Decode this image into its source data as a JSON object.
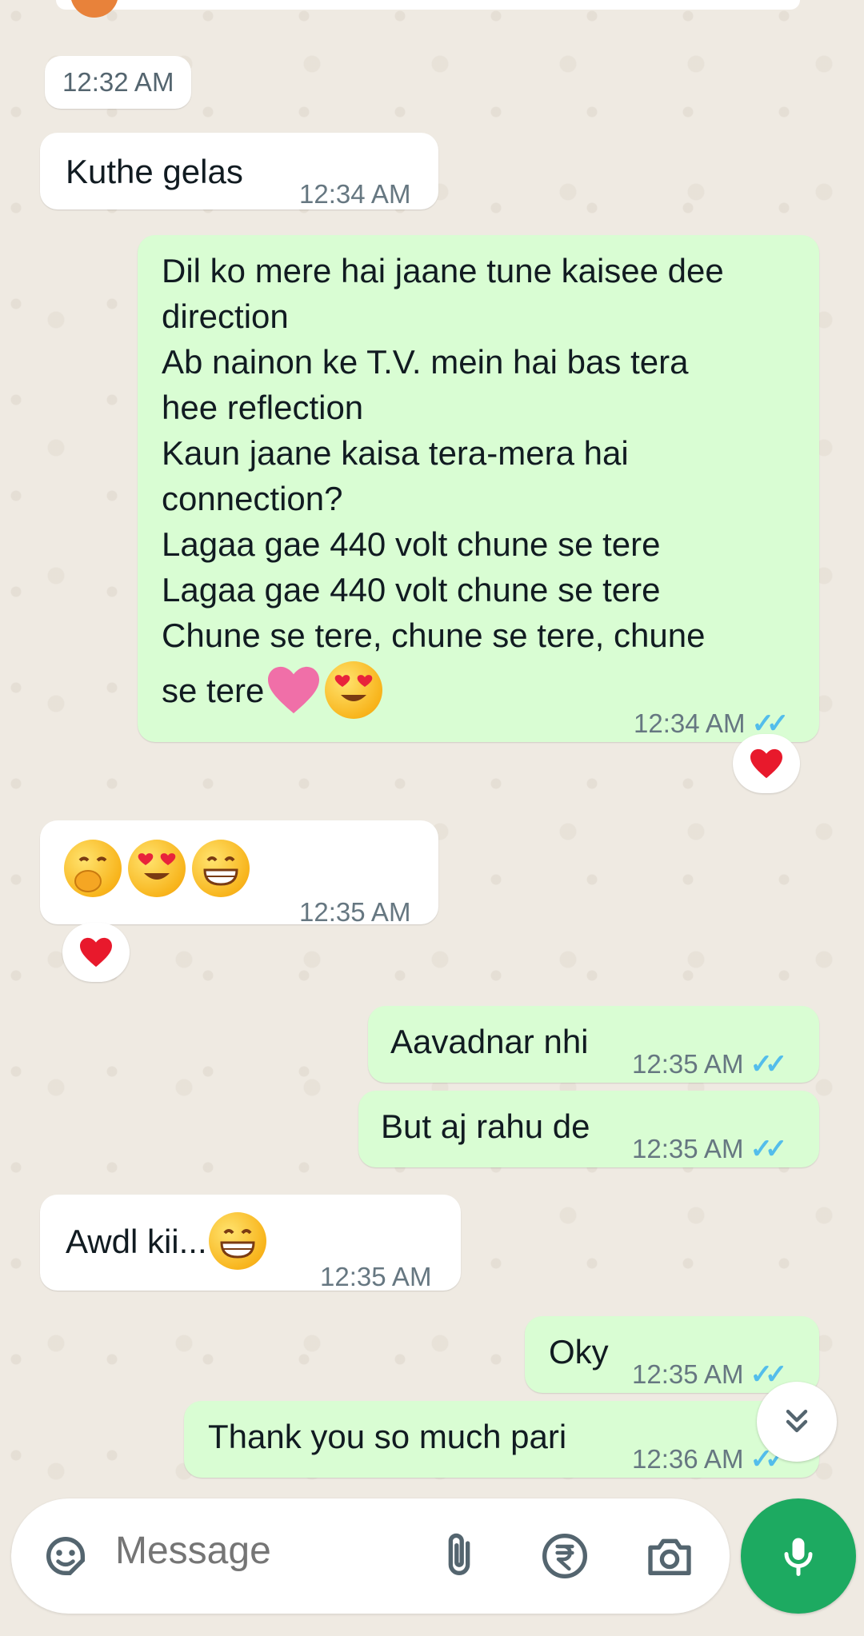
{
  "date_chip": "12:32 AM",
  "messages": [
    {
      "direction": "in",
      "text": "Kuthe gelas",
      "time": "12:34 AM"
    },
    {
      "direction": "out",
      "lines": [
        "Dil ko mere hai jaane tune kaisee dee",
        "direction",
        "Ab nainon ke T.V. mein hai bas tera",
        "hee reflection",
        "Kaun jaane kaisa tera-mera hai",
        "connection?",
        "Lagaa gae 440 volt chune se tere",
        "Lagaa gae 440 volt chune se tere",
        "Chune se tere, chune se tere, chune",
        "se tere"
      ],
      "emoji": [
        "pink-heart",
        "heart-eyes"
      ],
      "time": "12:34 AM",
      "status": "read",
      "reaction": "red-heart"
    },
    {
      "direction": "in",
      "emoji": [
        "hand-over-mouth",
        "heart-eyes",
        "grinning"
      ],
      "time": "12:35 AM",
      "reaction": "red-heart"
    },
    {
      "direction": "out",
      "text": "Aavadnar nhi",
      "time": "12:35 AM",
      "status": "read"
    },
    {
      "direction": "out",
      "text": "But aj rahu de",
      "time": "12:35 AM",
      "status": "read"
    },
    {
      "direction": "in",
      "text": "Awdl kii...",
      "emoji": [
        "grinning"
      ],
      "time": "12:35 AM"
    },
    {
      "direction": "out",
      "text": "Oky",
      "time": "12:35 AM",
      "status": "read"
    },
    {
      "direction": "out",
      "text": "Thank you so much pari",
      "time": "12:36 AM",
      "status": "read"
    }
  ],
  "composer": {
    "placeholder": "Message",
    "icons": [
      "sticker-icon",
      "attach-icon",
      "rupee-payment-icon",
      "camera-icon",
      "mic-icon"
    ]
  },
  "colors": {
    "background": "#efeae2",
    "incoming": "#ffffff",
    "outgoing": "#d9fdd3",
    "read_ticks": "#53bdeb",
    "send_button": "#1daa61"
  }
}
